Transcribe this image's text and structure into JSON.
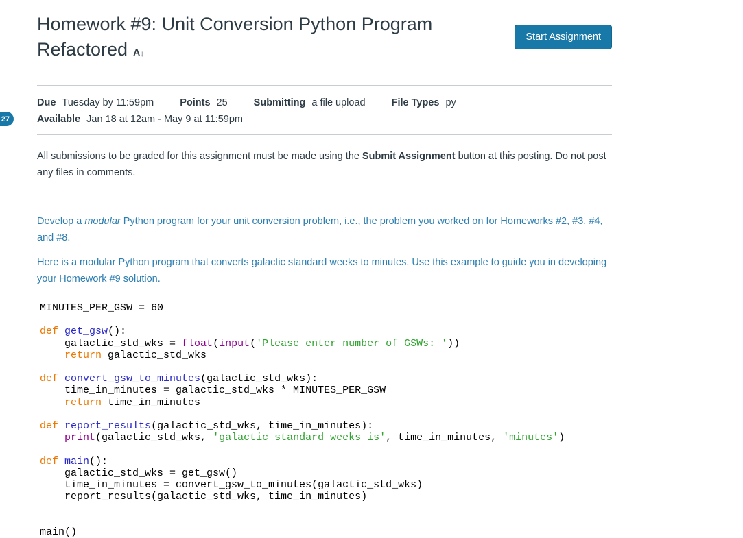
{
  "theme": {
    "accent_blue": "#1878a8",
    "link_text_blue": "#2d7eb1",
    "text_dark": "#2d3b45",
    "divider_gray": "#c7cdd1"
  },
  "badge": {
    "count": "27"
  },
  "header": {
    "title": "Homework #9: Unit Conversion Python Program Refactored",
    "title_icon_letter": "A",
    "title_icon_arrow": "↓",
    "start_button_label": "Start Assignment"
  },
  "meta": {
    "due": {
      "label": "Due",
      "value": "Tuesday by 11:59pm"
    },
    "points": {
      "label": "Points",
      "value": "25"
    },
    "submitting": {
      "label": "Submitting",
      "value": "a file upload"
    },
    "file_types": {
      "label": "File Types",
      "value": "py"
    },
    "available": {
      "label": "Available",
      "value": "Jan 18 at 12am - May 9 at 11:59pm"
    }
  },
  "notice": {
    "before_bold": "All submissions to be graded for this assignment must be made using the ",
    "bold": "Submit Assignment",
    "after_bold": " button at this posting. Do not post any files in comments."
  },
  "description": {
    "p1_before_italic": "Develop a ",
    "p1_italic": "modular",
    "p1_after_italic": " Python program for your unit conversion problem, i.e., the problem you worked on for Homeworks #2, #3, #4, and #8.",
    "p2": "Here is a modular Python program that converts galactic standard weeks to minutes. Use this example to guide you in developing your Homework #9 solution."
  },
  "code": {
    "language": "python",
    "colors": {
      "p": "#000000",
      "k": "#ee7700",
      "d": "#2a2acc",
      "b": "#900090",
      "s": "#2fa42f"
    },
    "lines": [
      [
        [
          "p",
          "MINUTES_PER_GSW = 60"
        ]
      ],
      [],
      [
        [
          "k",
          "def"
        ],
        [
          "p",
          " "
        ],
        [
          "d",
          "get_gsw"
        ],
        [
          "p",
          "():"
        ]
      ],
      [
        [
          "p",
          "    galactic_std_wks = "
        ],
        [
          "b",
          "float"
        ],
        [
          "p",
          "("
        ],
        [
          "b",
          "input"
        ],
        [
          "p",
          "("
        ],
        [
          "s",
          "'Please enter number of GSWs: '"
        ],
        [
          "p",
          "))"
        ]
      ],
      [
        [
          "p",
          "    "
        ],
        [
          "k",
          "return"
        ],
        [
          "p",
          " galactic_std_wks"
        ]
      ],
      [],
      [
        [
          "k",
          "def"
        ],
        [
          "p",
          " "
        ],
        [
          "d",
          "convert_gsw_to_minutes"
        ],
        [
          "p",
          "(galactic_std_wks):"
        ]
      ],
      [
        [
          "p",
          "    time_in_minutes = galactic_std_wks * MINUTES_PER_GSW"
        ]
      ],
      [
        [
          "p",
          "    "
        ],
        [
          "k",
          "return"
        ],
        [
          "p",
          " time_in_minutes"
        ]
      ],
      [],
      [
        [
          "k",
          "def"
        ],
        [
          "p",
          " "
        ],
        [
          "d",
          "report_results"
        ],
        [
          "p",
          "(galactic_std_wks, time_in_minutes):"
        ]
      ],
      [
        [
          "p",
          "    "
        ],
        [
          "b",
          "print"
        ],
        [
          "p",
          "(galactic_std_wks, "
        ],
        [
          "s",
          "'galactic standard weeks is'"
        ],
        [
          "p",
          ", time_in_minutes, "
        ],
        [
          "s",
          "'minutes'"
        ],
        [
          "p",
          ")"
        ]
      ],
      [],
      [
        [
          "k",
          "def"
        ],
        [
          "p",
          " "
        ],
        [
          "d",
          "main"
        ],
        [
          "p",
          "():"
        ]
      ],
      [
        [
          "p",
          "    galactic_std_wks = get_gsw()"
        ]
      ],
      [
        [
          "p",
          "    time_in_minutes = convert_gsw_to_minutes(galactic_std_wks)"
        ]
      ],
      [
        [
          "p",
          "    report_results(galactic_std_wks, time_in_minutes)"
        ]
      ],
      [],
      [],
      [
        [
          "p",
          "main()"
        ]
      ]
    ]
  }
}
